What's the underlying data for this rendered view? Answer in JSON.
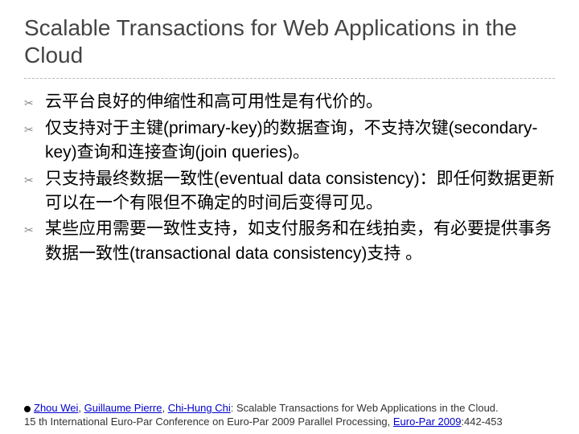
{
  "title": "Scalable Transactions for Web Applications in the Cloud",
  "bullets": [
    "云平台良好的伸缩性和高可用性是有代价的。",
    "仅支持对于主键(primary-key)的数据查询，不支持次键(secondary-key)查询和连接查询(join queries)。",
    "只支持最终数据一致性(eventual data consistency)：即任何数据更新可以在一个有限但不确定的时间后变得可见。",
    "某些应用需要一致性支持，如支付服务和在线拍卖，有必要提供事务数据一致性(transactional data consistency)支持 。"
  ],
  "footer": {
    "author1": "Zhou Wei",
    "sep1": ", ",
    "author2": "Guillaume Pierre",
    "sep2": ", ",
    "author3": "Chi-Hung Chi",
    "rest1": ": Scalable Transactions for Web Applications in the Cloud. ",
    "rest2": "15 th International Euro-Par Conference on Euro-Par 2009 Parallel Processing, ",
    "venue": "Euro-Par 2009",
    "pages": ":442-453"
  }
}
